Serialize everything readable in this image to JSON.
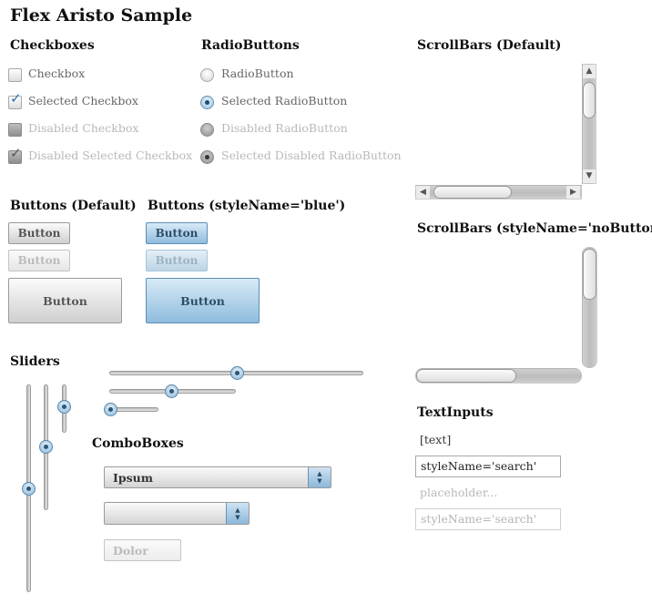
{
  "page": {
    "title": "Flex Aristo Sample"
  },
  "checkboxes": {
    "title": "Checkboxes",
    "items": [
      {
        "label": "Checkbox",
        "selected": false,
        "disabled": false
      },
      {
        "label": "Selected Checkbox",
        "selected": true,
        "disabled": false
      },
      {
        "label": "Disabled Checkbox",
        "selected": false,
        "disabled": true
      },
      {
        "label": "Disabled Selected Checkbox",
        "selected": true,
        "disabled": true
      }
    ]
  },
  "radiobuttons": {
    "title": "RadioButtons",
    "items": [
      {
        "label": "RadioButton",
        "selected": false,
        "disabled": false
      },
      {
        "label": "Selected RadioButton",
        "selected": true,
        "disabled": false
      },
      {
        "label": "Disabled RadioButton",
        "selected": false,
        "disabled": true
      },
      {
        "label": "Selected Disabled RadioButton",
        "selected": true,
        "disabled": true
      }
    ]
  },
  "scrollbars_default": {
    "title": "ScrollBars (Default)"
  },
  "scrollbars_nobuttons": {
    "title": "ScrollBars (styleName='noButtons')"
  },
  "buttons_default": {
    "title": "Buttons (Default)",
    "normal": "Button",
    "disabled": "Button",
    "large": "Button"
  },
  "buttons_blue": {
    "title": "Buttons (styleName='blue')",
    "normal": "Button",
    "disabled": "Button",
    "large": "Button"
  },
  "sliders": {
    "title": "Sliders"
  },
  "comboboxes": {
    "title": "ComboBoxes",
    "items": [
      {
        "value": "Ipsum",
        "disabled": false
      },
      {
        "value": "",
        "disabled": false
      },
      {
        "value": "Dolor",
        "disabled": true
      }
    ]
  },
  "textinputs": {
    "title": "TextInputs",
    "plain_text": "[text]",
    "search_text": "styleName='search'",
    "placeholder": "placeholder...",
    "search_disabled_text": "styleName='search'"
  },
  "colors": {
    "accent_blue": "#8cb8da",
    "disabled_text": "#b8b8b8"
  },
  "icons": {
    "checkmark": "check-icon",
    "up": "arrow-up-icon",
    "down": "arrow-down-icon",
    "left": "arrow-left-icon",
    "right": "arrow-right-icon"
  }
}
